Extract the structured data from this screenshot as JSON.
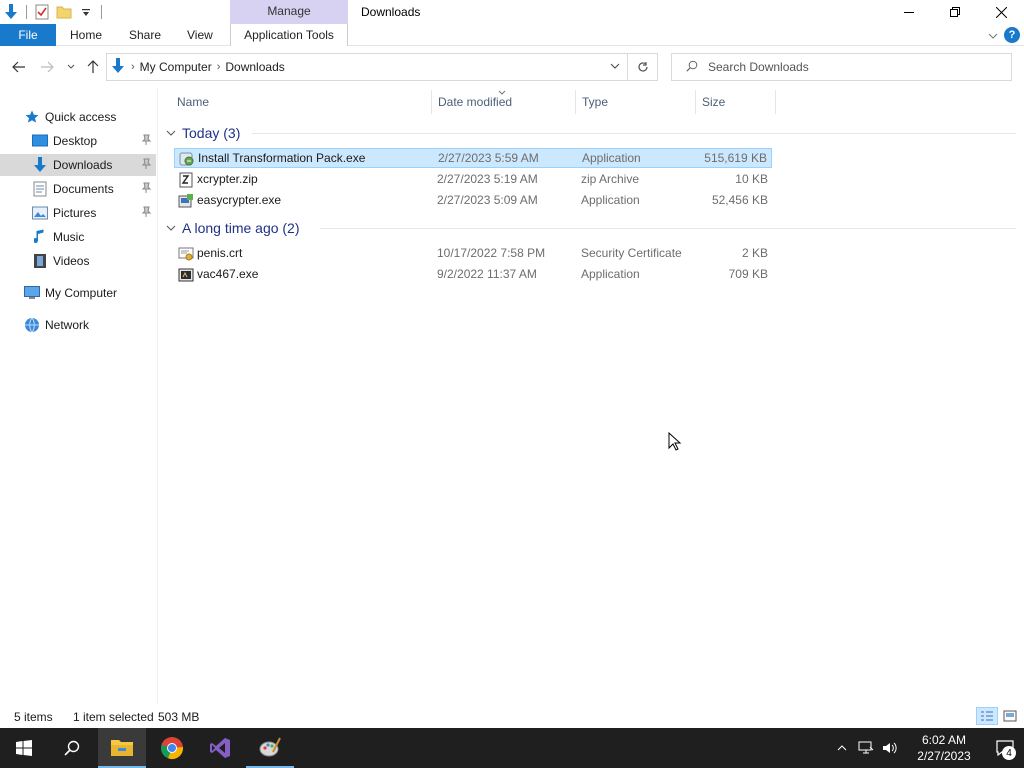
{
  "window": {
    "title": "Downloads",
    "context_group": "Manage",
    "accent": "#1979ca",
    "context_color": "#d8d2f2"
  },
  "ribbon": {
    "tabs": [
      "File",
      "Home",
      "Share",
      "View",
      "Application Tools"
    ],
    "help": "?"
  },
  "address": {
    "crumbs": [
      "My Computer",
      "Downloads"
    ]
  },
  "search": {
    "placeholder": "Search Downloads"
  },
  "navpane": {
    "items": [
      {
        "label": "Quick access",
        "icon": "star-icon"
      },
      {
        "label": "Desktop",
        "icon": "desktop-icon",
        "pinned": true
      },
      {
        "label": "Downloads",
        "icon": "download-arrow-icon",
        "pinned": true,
        "selected": true
      },
      {
        "label": "Documents",
        "icon": "documents-icon",
        "pinned": true
      },
      {
        "label": "Pictures",
        "icon": "pictures-icon",
        "pinned": true
      },
      {
        "label": "Music",
        "icon": "music-note-icon"
      },
      {
        "label": "Videos",
        "icon": "film-icon"
      },
      {
        "label": "My Computer",
        "icon": "computer-icon"
      },
      {
        "label": "Network",
        "icon": "network-icon"
      }
    ]
  },
  "columns": [
    "Name",
    "Date modified",
    "Type",
    "Size"
  ],
  "groups": [
    {
      "label": "Today (3)",
      "files": [
        {
          "name": "Install Transformation Pack.exe",
          "date": "2/27/2023 5:59 AM",
          "type": "Application",
          "size": "515,619 KB",
          "icon": "installer-icon",
          "selected": true
        },
        {
          "name": "xcrypter.zip",
          "date": "2/27/2023 5:19 AM",
          "type": "zip Archive",
          "size": "10 KB",
          "icon": "zip-icon"
        },
        {
          "name": "easycrypter.exe",
          "date": "2/27/2023 5:09 AM",
          "type": "Application",
          "size": "52,456 KB",
          "icon": "app-icon"
        }
      ]
    },
    {
      "label": "A long time ago (2)",
      "files": [
        {
          "name": "penis.crt",
          "date": "10/17/2022 7:58 PM",
          "type": "Security Certificate",
          "size": "2 KB",
          "icon": "certificate-icon"
        },
        {
          "name": "vac467.exe",
          "date": "9/2/2022 11:37 AM",
          "type": "Application",
          "size": "709 KB",
          "icon": "app-icon"
        }
      ]
    }
  ],
  "status": {
    "item_count": "5 items",
    "selection": "1 item selected",
    "selection_size": "503 MB"
  },
  "taskbar": {
    "time": "6:02 AM",
    "date": "2/27/2023",
    "notification_count": "4"
  }
}
